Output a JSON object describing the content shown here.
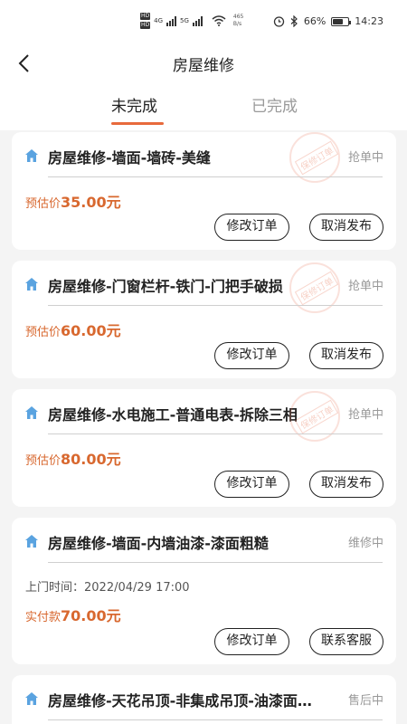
{
  "status_bar": {
    "hd1": "HD",
    "hd2": "HD",
    "signal1": "4G",
    "signal2": "5G",
    "net_speed": "465",
    "net_unit": "B/s",
    "battery": "66%",
    "battery_level": 0.66,
    "time": "14:23",
    "icons": [
      "alarm-icon",
      "bluetooth-icon",
      "wifi-icon"
    ]
  },
  "header": {
    "title": "房屋维修"
  },
  "tabs": [
    {
      "label": "未完成",
      "active": true
    },
    {
      "label": "已完成",
      "active": false
    }
  ],
  "colors": {
    "accent": "#e86a3c",
    "price": "#d8682f",
    "house_icon": "#5aa3e0"
  },
  "orders": [
    {
      "title": "房屋维修-墙面-墙砖-美缝",
      "status": "抢单中",
      "stamp": "保修订单",
      "visit_label": "",
      "visit_time": "",
      "price_label": "预估价",
      "price": "35.00元",
      "button1": "修改订单",
      "button2": "取消发布"
    },
    {
      "title": "房屋维修-门窗栏杆-铁门-门把手破损",
      "status": "抢单中",
      "stamp": "保修订单",
      "visit_label": "",
      "visit_time": "",
      "price_label": "预估价",
      "price": "60.00元",
      "button1": "修改订单",
      "button2": "取消发布"
    },
    {
      "title": "房屋维修-水电施工-普通电表-拆除三相",
      "status": "抢单中",
      "stamp": "保修订单",
      "visit_label": "",
      "visit_time": "",
      "price_label": "预估价",
      "price": "80.00元",
      "button1": "修改订单",
      "button2": "取消发布"
    },
    {
      "title": "房屋维修-墙面-内墙油漆-漆面粗糙",
      "status": "维修中",
      "stamp": "",
      "visit_label": "上门时间：",
      "visit_time": "2022/04/29 17:00",
      "price_label": "实付款",
      "price": "70.00元",
      "button1": "修改订单",
      "button2": "联系客服"
    },
    {
      "title": "房屋维修-天花吊顶-非集成吊顶-油漆面…",
      "status": "售后中",
      "stamp": "",
      "visit_label": "",
      "visit_time": "",
      "price_label": "",
      "price": "",
      "button1": "",
      "button2": ""
    }
  ]
}
